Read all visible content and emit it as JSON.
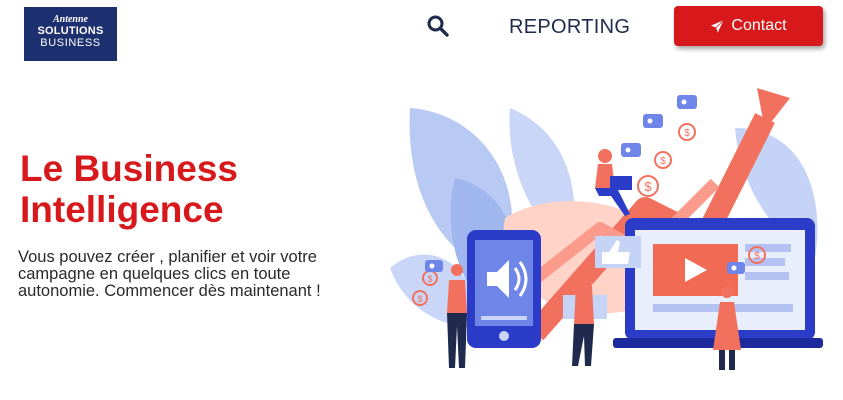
{
  "header": {
    "logo": {
      "brand": "Antenne",
      "line1": "SOLUTIONS",
      "line2": "BUSINESS"
    },
    "search_icon": "search-icon",
    "nav_reporting": "REPORTING",
    "contact_label": "Contact",
    "contact_icon": "paper-plane-icon"
  },
  "hero": {
    "title_line1": "Le Business",
    "title_line2": "Intelligence",
    "subtitle_lines": [
      "Vous pouvez créer , planifier et voir votre",
      "campagne en quelques clics en toute",
      "autonomie. Commencer dès maintenant !"
    ]
  },
  "colors": {
    "accent": "#d8191b",
    "navy": "#1c2f6f",
    "nav_text": "#1f2a4d"
  }
}
